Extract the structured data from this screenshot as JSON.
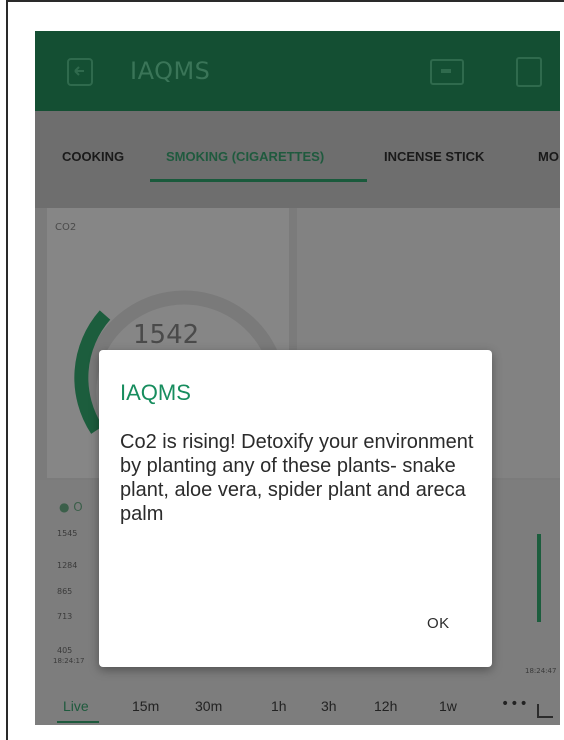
{
  "app": {
    "title": "IAQMS"
  },
  "tabs": [
    {
      "label": "COOKING"
    },
    {
      "label": "SMOKING (CIGARETTES)"
    },
    {
      "label": "INCENSE STICK"
    },
    {
      "label": "MO"
    }
  ],
  "gauge": {
    "label": "CO2",
    "value": "1542"
  },
  "chart": {
    "title_partial": "● O",
    "y_ticks": [
      "1545",
      "1284",
      "865",
      "713",
      "405"
    ],
    "x_start": "18:24:17",
    "x_end": "18:24:47"
  },
  "ranges": [
    "Live",
    "15m",
    "30m",
    "1h",
    "3h",
    "12h",
    "1w"
  ],
  "range_more": "•••",
  "dialog": {
    "title": "IAQMS",
    "message": "Co2 is rising! Detoxify your environment by planting any of these plants- snake plant, aloe vera, spider plant and areca palm",
    "ok_label": "OK"
  },
  "colors": {
    "app_bar": "#144f33",
    "accent": "#178d5e",
    "scrim": "#7d7d7d"
  }
}
